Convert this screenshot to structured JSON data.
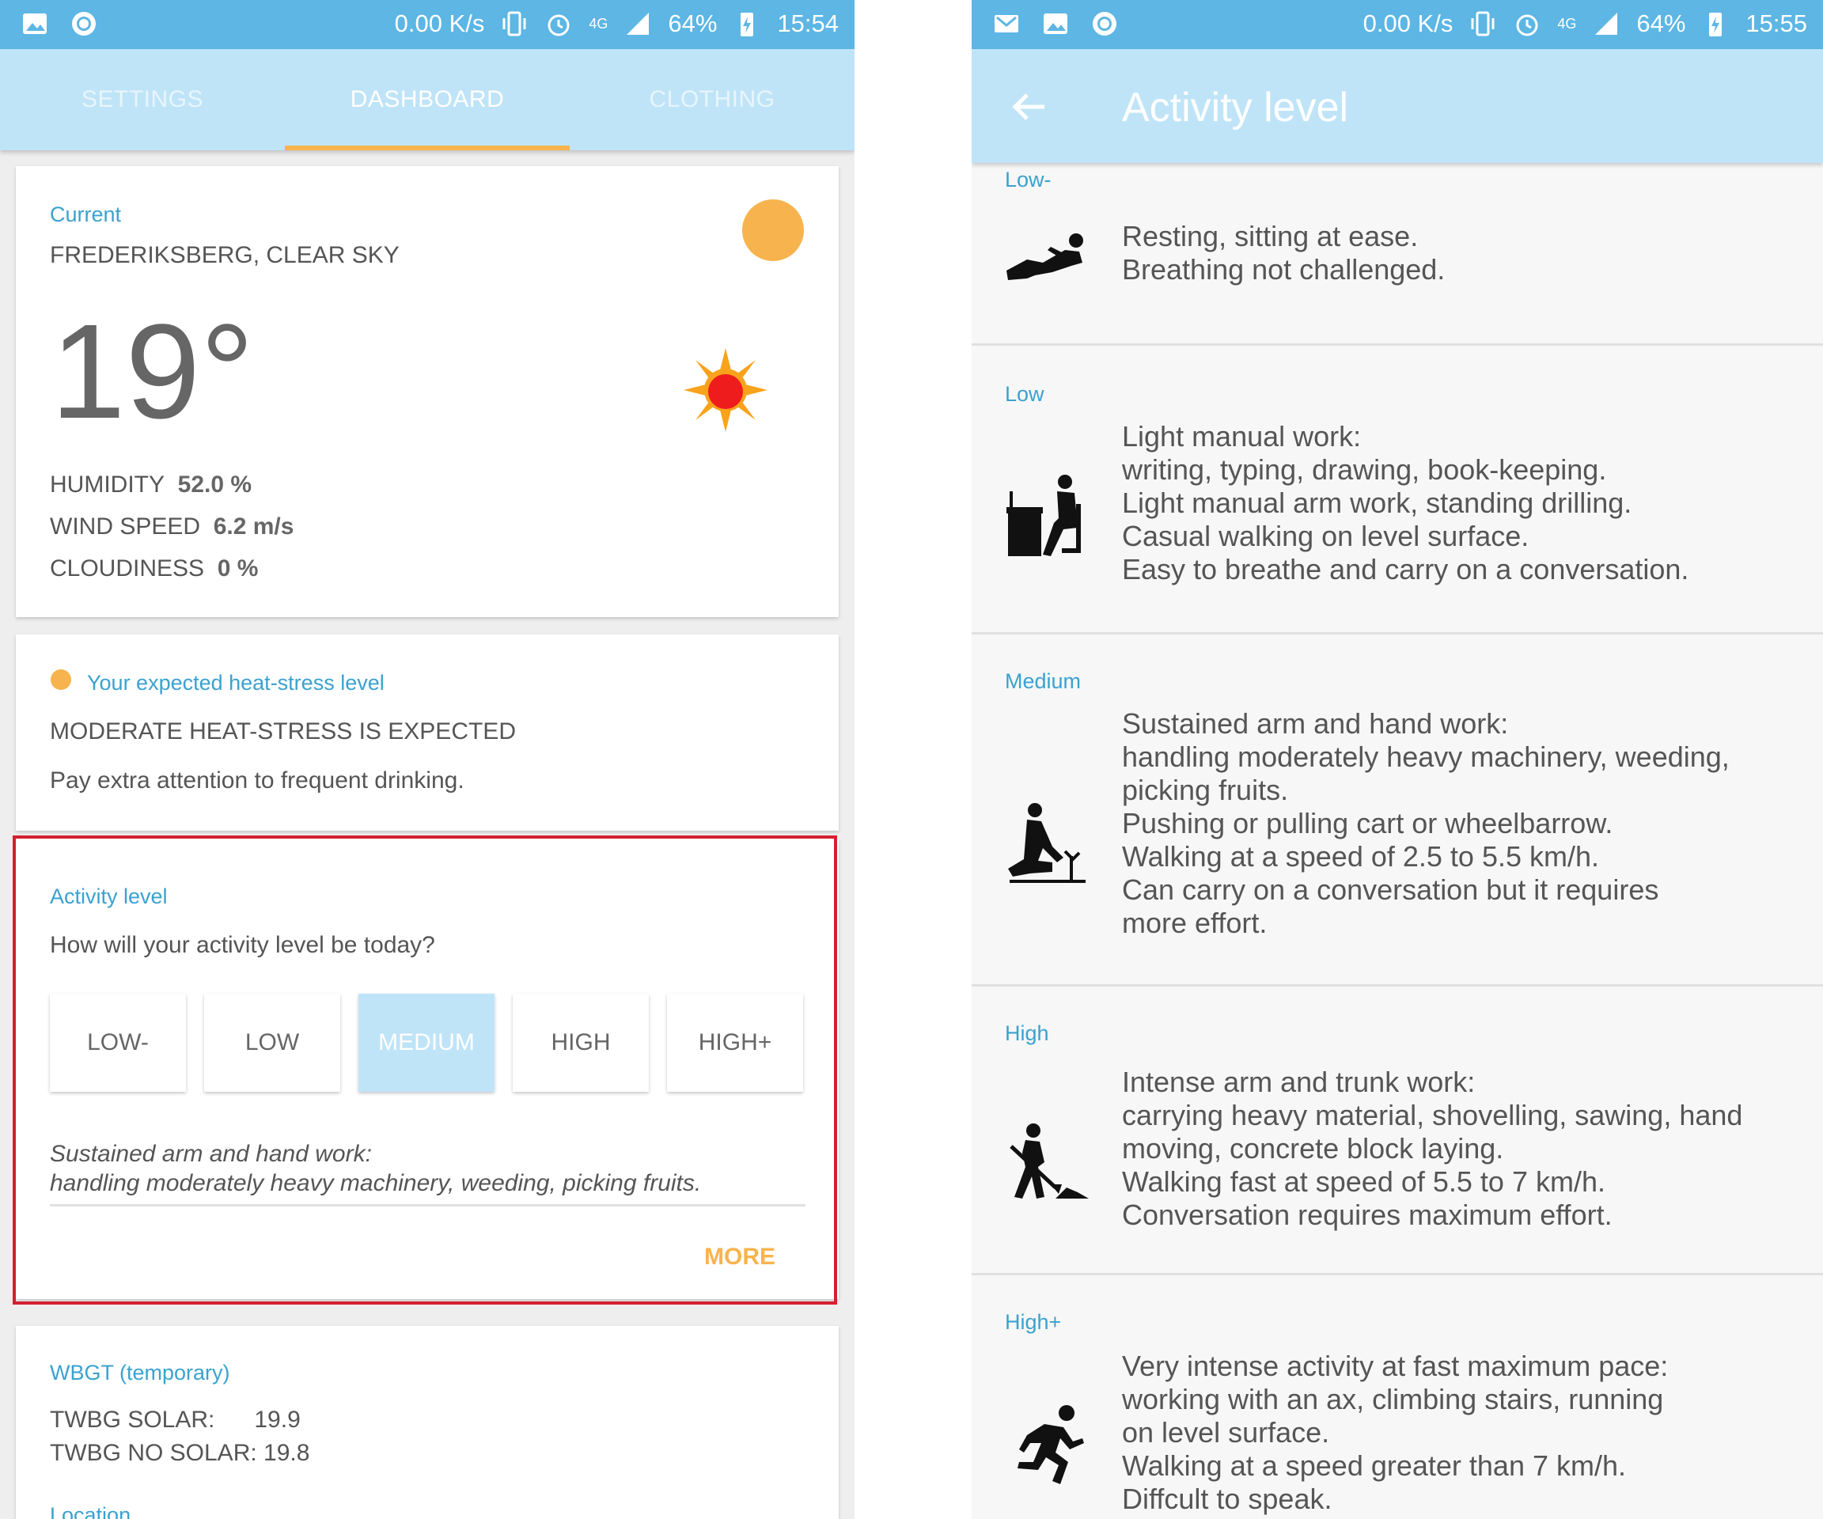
{
  "left": {
    "status": {
      "speed": "0.00 K/s",
      "network": "4G",
      "battery": "64%",
      "time": "15:54"
    },
    "tabs": [
      {
        "label": "SETTINGS"
      },
      {
        "label": "DASHBOARD"
      },
      {
        "label": "CLOTHING"
      }
    ],
    "current": {
      "title": "Current",
      "location": "FREDERIKSBERG, CLEAR SKY",
      "temperature": "19°",
      "humidity_label": "HUMIDITY",
      "humidity_value": "52.0 %",
      "wind_label": "WIND SPEED",
      "wind_value": "6.2 m/s",
      "cloud_label": "CLOUDINESS",
      "cloud_value": "0 %"
    },
    "heat": {
      "title": "Your expected heat-stress level",
      "level": "MODERATE HEAT-STRESS IS EXPECTED",
      "advice": "Pay extra attention to frequent drinking."
    },
    "activity": {
      "title": "Activity level",
      "question": "How will your activity level be today?",
      "options": [
        "LOW-",
        "LOW",
        "MEDIUM",
        "HIGH",
        "HIGH+"
      ],
      "selected": "MEDIUM",
      "description_line1": "Sustained arm and hand work:",
      "description_line2": "handling moderately heavy machinery, weeding, picking fruits.",
      "more": "MORE"
    },
    "wbgt": {
      "title": "WBGT (temporary)",
      "solar_label": "TWBG SOLAR:",
      "solar_value": "19.9",
      "nosolar_label": "TWBG NO SOLAR:",
      "nosolar_value": "19.8",
      "location_label": "Location"
    },
    "colors": {
      "status": "#5db6e4",
      "appbar": "#bfe4f8",
      "accent": "#f7b44e",
      "link": "#3aa2cf",
      "highlight": "#d3202f"
    }
  },
  "right": {
    "status": {
      "speed": "0.00 K/s",
      "network": "4G",
      "battery": "64%",
      "time": "15:55"
    },
    "title": "Activity level",
    "sections": [
      {
        "title": "Low-",
        "icon": "resting-person-icon",
        "lines": [
          "Resting, sitting at ease.",
          "Breathing not challenged."
        ]
      },
      {
        "title": "Low",
        "icon": "desk-worker-icon",
        "lines": [
          "Light manual work:",
          "writing, typing, drawing, book-keeping.",
          "Light manual arm work, standing drilling.",
          "Casual walking on level surface.",
          "Easy to breathe and carry on a conversation."
        ]
      },
      {
        "title": "Medium",
        "icon": "gardener-icon",
        "lines": [
          "Sustained arm and hand work:",
          "handling moderately heavy machinery, weeding,",
          "picking fruits.",
          "Pushing or pulling cart or wheelbarrow.",
          "Walking at a speed of 2.5 to 5.5 km/h.",
          "Can carry on a conversation but it requires",
          "more effort."
        ]
      },
      {
        "title": "High",
        "icon": "shoveling-person-icon",
        "lines": [
          "Intense arm and trunk work:",
          "carrying heavy material, shovelling, sawing, hand",
          "moving, concrete block laying.",
          "Walking fast at speed of 5.5 to 7 km/h.",
          "Conversation requires maximum effort."
        ]
      },
      {
        "title": "High+",
        "icon": "running-person-icon",
        "lines": [
          "Very intense activity at fast maximum pace:",
          "working with an ax, climbing stairs, running",
          "on level surface.",
          "Walking at a speed greater than 7 km/h.",
          "Diffcult to speak."
        ]
      }
    ]
  }
}
